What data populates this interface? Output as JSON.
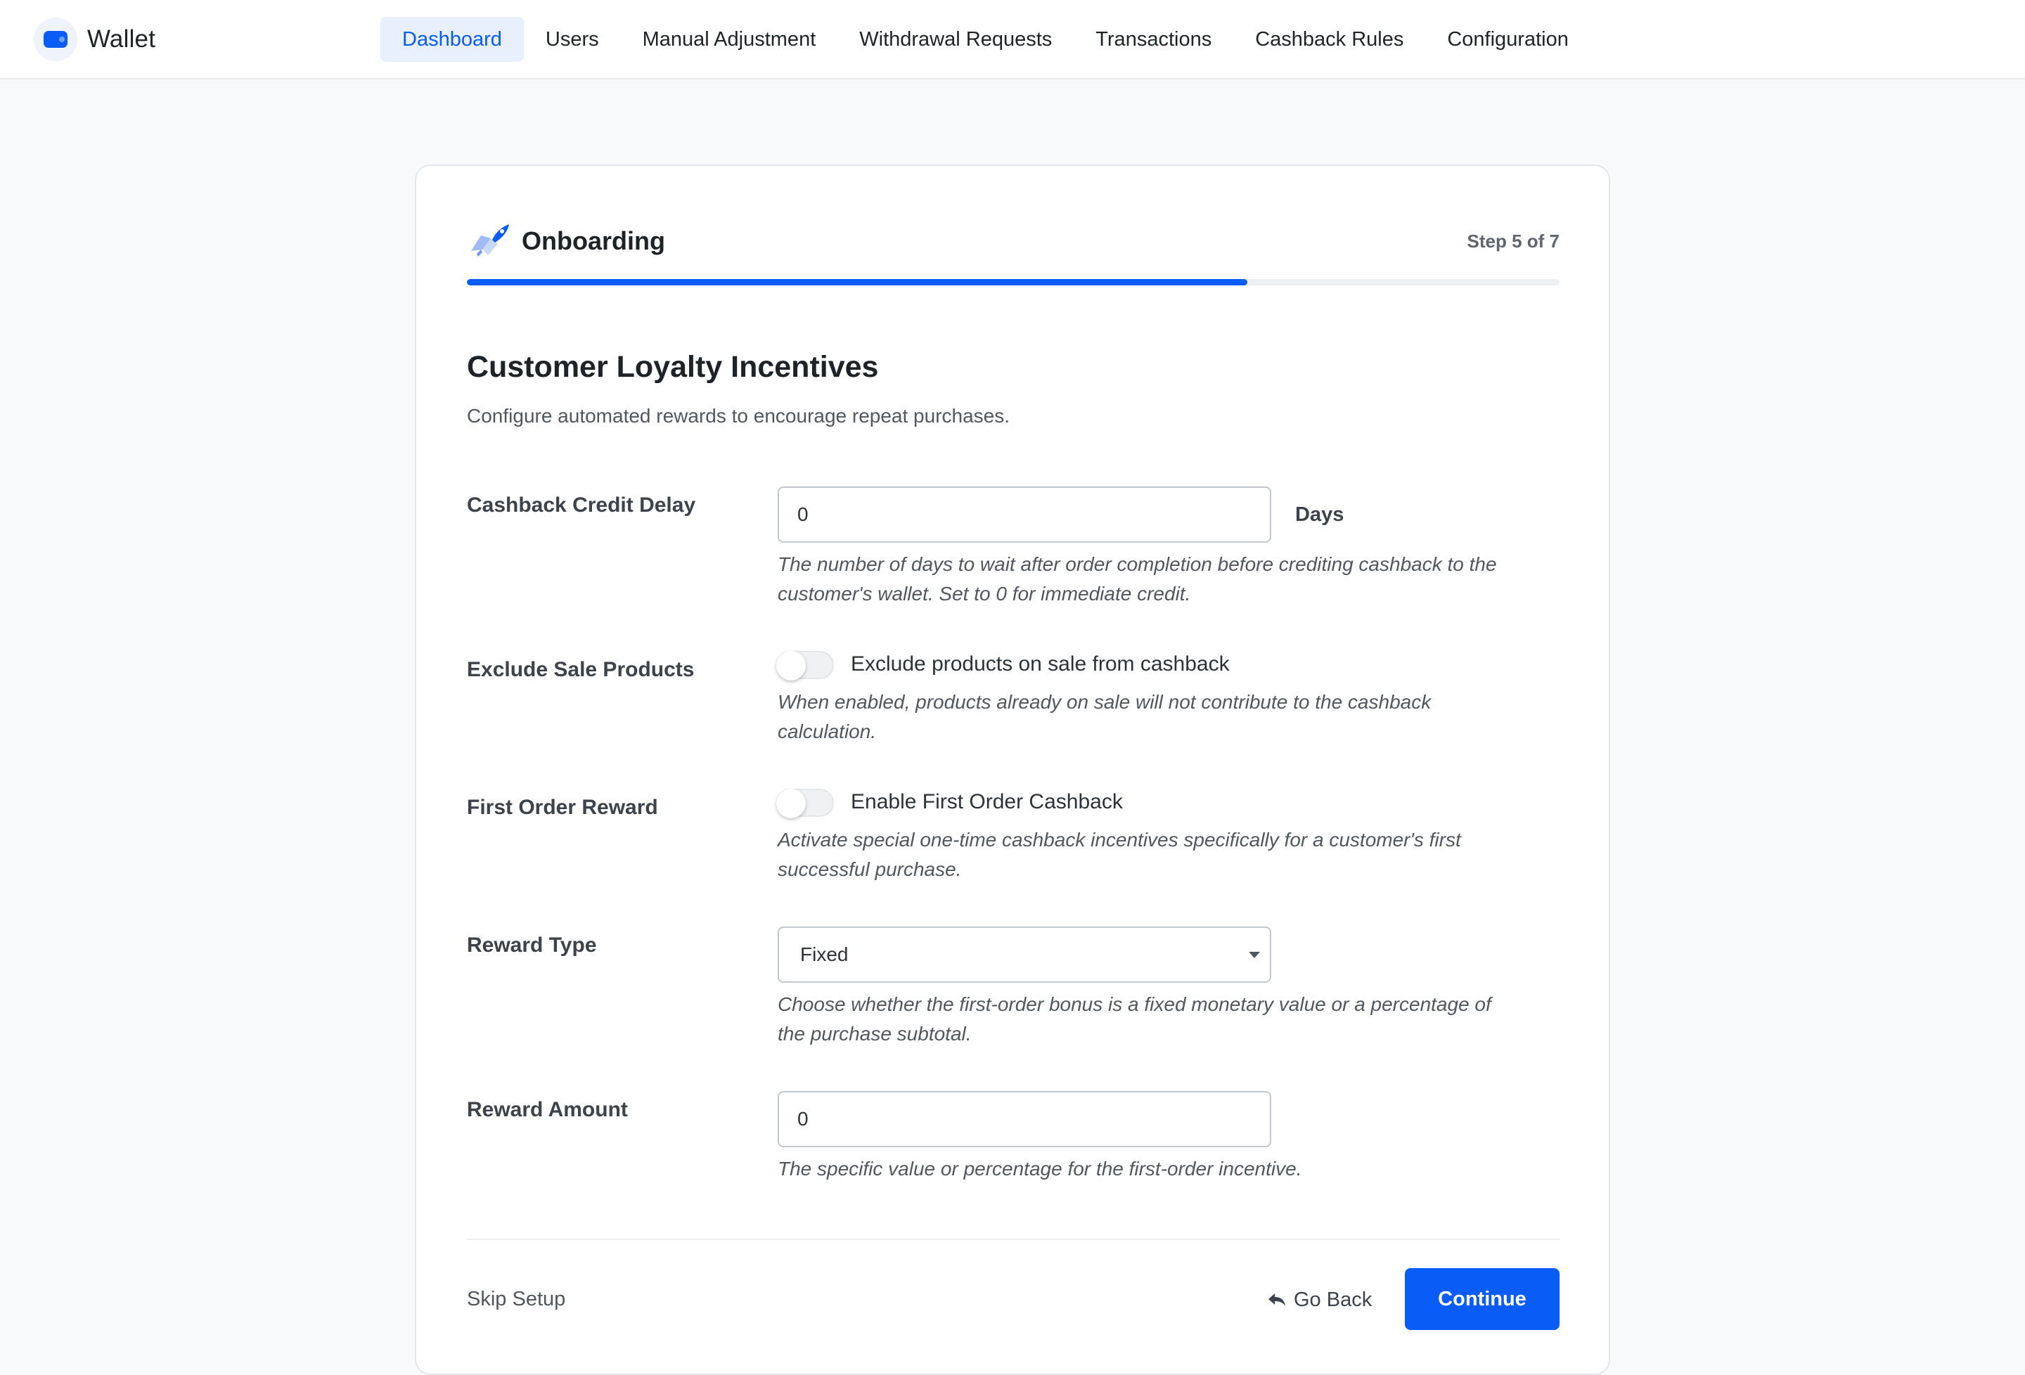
{
  "app": {
    "name": "Wallet",
    "icon": "wallet-icon"
  },
  "nav": {
    "items": [
      {
        "label": "Dashboard",
        "active": true
      },
      {
        "label": "Users"
      },
      {
        "label": "Manual Adjustment"
      },
      {
        "label": "Withdrawal Requests"
      },
      {
        "label": "Transactions"
      },
      {
        "label": "Cashback Rules"
      },
      {
        "label": "Configuration"
      }
    ]
  },
  "onboarding": {
    "title": "Onboarding",
    "icon": "rocket-icon",
    "step_text": "Step 5 of 7",
    "progress": 0.714
  },
  "section": {
    "title": "Customer Loyalty Incentives",
    "description": "Configure automated rewards to encourage repeat purchases."
  },
  "fields": {
    "credit_delay": {
      "label": "Cashback Credit Delay",
      "value": "0",
      "suffix": "Days",
      "help_line1": "The number of days to wait after order completion before crediting cashback to the",
      "help_line2": "customer's wallet. Set to 0 for immediate credit."
    },
    "exclude_sale": {
      "label": "Exclude Sale Products",
      "toggle_label": "Exclude products on sale from cashback",
      "enabled": false,
      "help_line1": "When enabled, products already on sale will not contribute to the cashback",
      "help_line2": "calculation."
    },
    "first_order": {
      "label": "First Order Reward",
      "toggle_label": "Enable First Order Cashback",
      "enabled": false,
      "help_line1": "Activate special one-time cashback incentives specifically for a customer's first",
      "help_line2": "successful purchase."
    },
    "reward_type": {
      "label": "Reward Type",
      "selected": "Fixed",
      "help_line1": "Choose whether the first-order bonus is a fixed monetary value or a percentage of",
      "help_line2": "the purchase subtotal."
    },
    "reward_amount": {
      "label": "Reward Amount",
      "value": "0",
      "help_line1": "The specific value or percentage for the first-order incentive."
    }
  },
  "footer": {
    "skip_label": "Skip Setup",
    "back_label": "Go Back",
    "continue_label": "Continue"
  },
  "colors": {
    "accent": "#0a5cf6",
    "background": "#f8f9fb"
  }
}
